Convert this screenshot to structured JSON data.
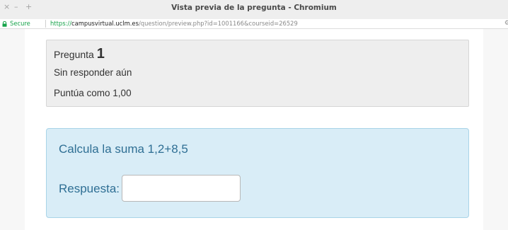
{
  "window": {
    "title": "Vista previa de la pregunta - Chromium",
    "close_glyph": "×",
    "minimize_glyph": "–",
    "maximize_glyph": "+"
  },
  "addressbar": {
    "secure_label": "Secure",
    "url_scheme": "https://",
    "url_host": "campusvirtual.uclm.es",
    "url_path": "/question/preview.php?id=1001166&courseid=26529",
    "lock_icon": "lock-icon",
    "settings_glyph": "⚙"
  },
  "question_info": {
    "label": "Pregunta",
    "number": "1",
    "state": "Sin responder aún",
    "grade": "Puntúa como 1,00"
  },
  "formulation": {
    "question_text": "Calcula la suma 1,2+8,5",
    "answer_label": "Respuesta:",
    "answer_value": ""
  },
  "colors": {
    "secure_green": "#16a34a",
    "info_bg": "#eeeeee",
    "formulation_bg": "#d9edf7",
    "formulation_text": "#2f6f94"
  }
}
